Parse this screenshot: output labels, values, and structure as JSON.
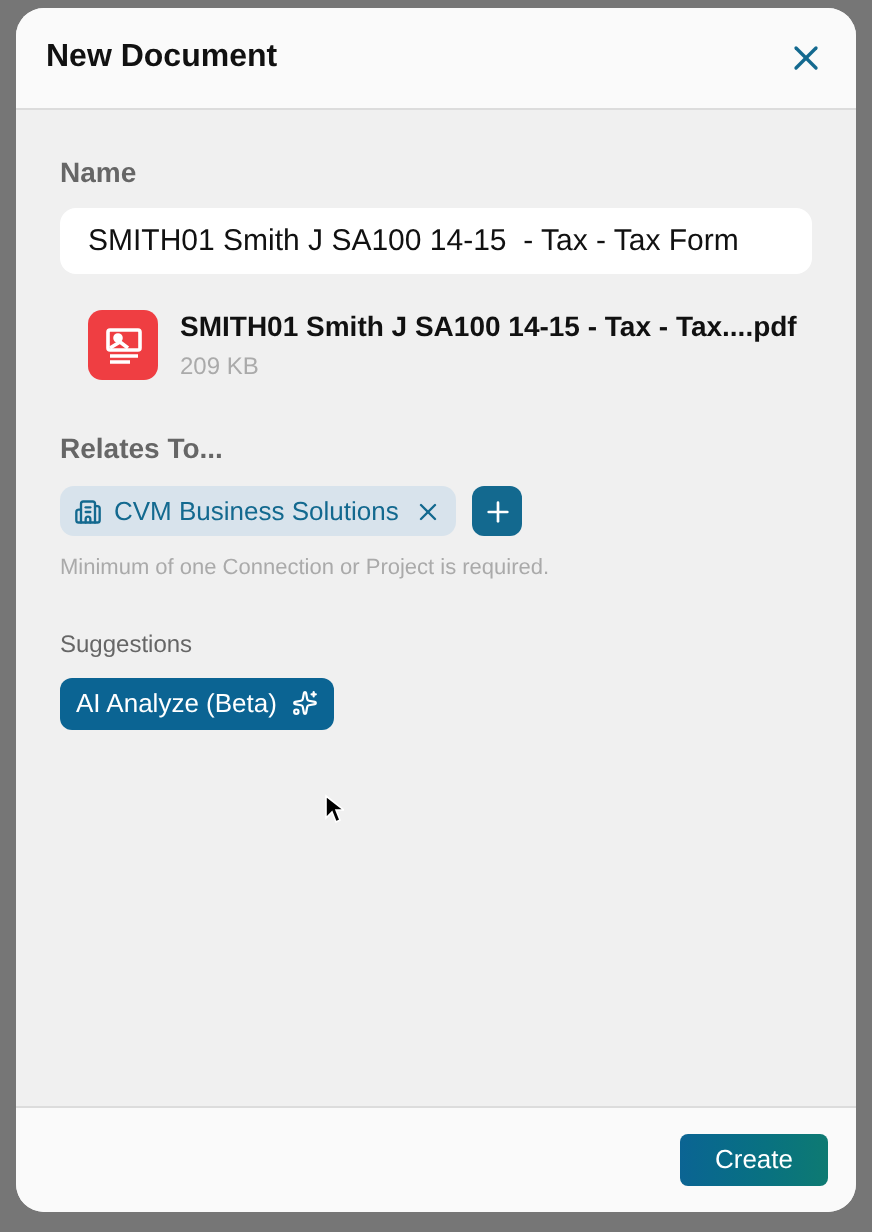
{
  "dialog": {
    "title": "New Document"
  },
  "name_field": {
    "label": "Name",
    "value": "SMITH01 Smith J SA100 14-15  - Tax - Tax Form"
  },
  "file": {
    "name": "SMITH01 Smith J SA100 14-15 - Tax - Tax....pdf",
    "size": "209 KB"
  },
  "relates_to": {
    "label": "Relates To...",
    "chips": [
      {
        "label": "CVM Business Solutions"
      }
    ],
    "hint": "Minimum of one Connection or Project is required."
  },
  "suggestions": {
    "label": "Suggestions",
    "buttons": [
      "AI Analyze (Beta)"
    ]
  },
  "footer": {
    "buttons": [
      "Create"
    ]
  }
}
